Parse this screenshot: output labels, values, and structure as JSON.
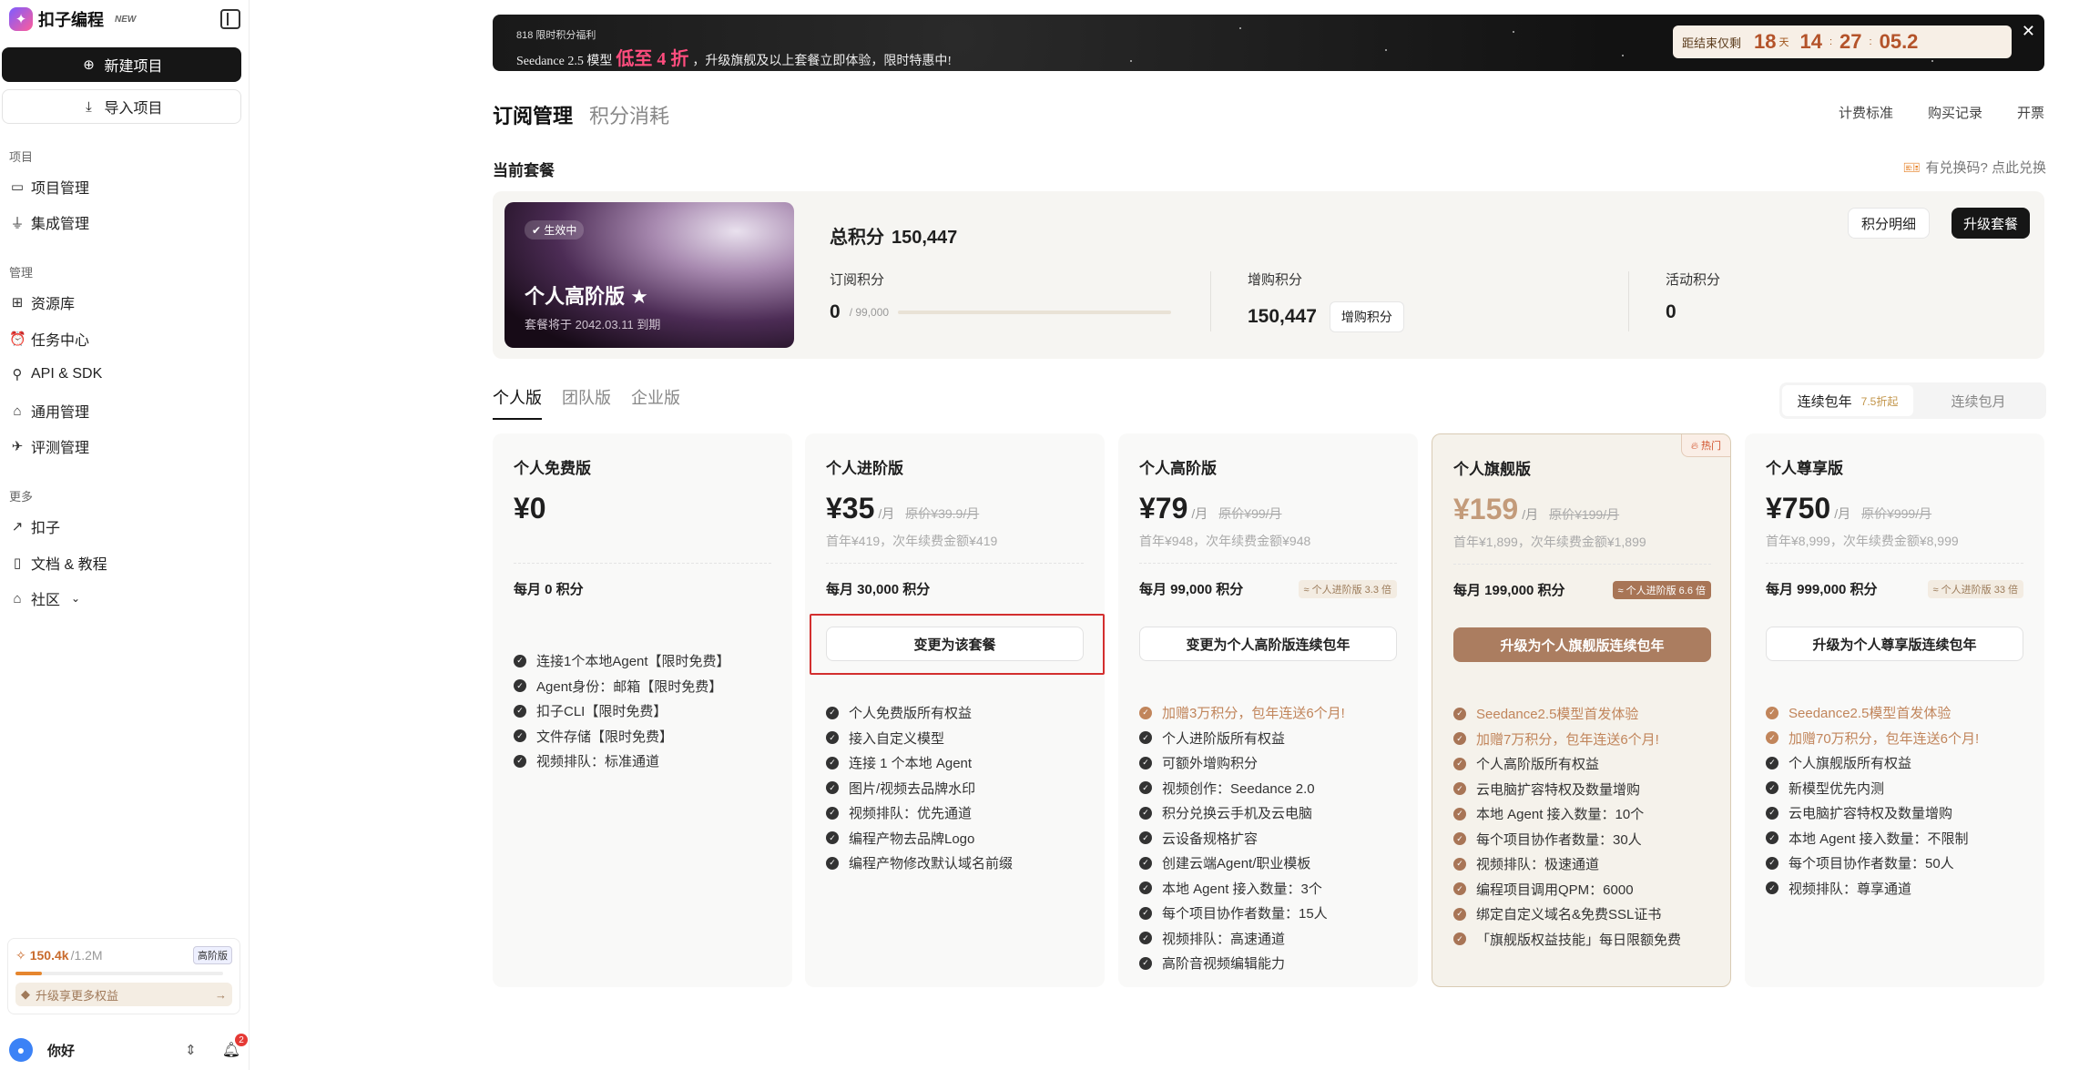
{
  "sidebar": {
    "brand": "扣子编程",
    "new_badge": "NEW",
    "new_project": "新建项目",
    "import_project": "导入项目",
    "sections": [
      {
        "label": "项目",
        "items": [
          {
            "label": "项目管理",
            "icon": "folder-icon"
          },
          {
            "label": "集成管理",
            "icon": "plug-icon"
          }
        ]
      },
      {
        "label": "管理",
        "items": [
          {
            "label": "资源库",
            "icon": "grid-icon"
          },
          {
            "label": "任务中心",
            "icon": "alarm-icon"
          },
          {
            "label": "API & SDK",
            "icon": "api-icon"
          },
          {
            "label": "通用管理",
            "icon": "store-icon"
          },
          {
            "label": "评测管理",
            "icon": "telescope-icon"
          }
        ]
      },
      {
        "label": "更多",
        "items": [
          {
            "label": "扣子",
            "icon": "arrow-up-right-icon"
          },
          {
            "label": "文档 & 教程",
            "icon": "book-icon"
          },
          {
            "label": "社区",
            "icon": "community-icon"
          }
        ]
      }
    ],
    "usage": {
      "value": "150.4k",
      "total": "/1.2M",
      "tier": "高阶版",
      "fraction": 0.125,
      "tip": "升级享更多权益"
    },
    "user": {
      "name": "你好",
      "notifications": "2"
    }
  },
  "banner": {
    "small": "818 限时积分福利",
    "pre": "Seedance 2.5 模型",
    "highlight": "低至 4 折",
    "post": "，升级旗舰及以上套餐立即体验，限时特惠中!",
    "countdown_label": "距结束仅剩",
    "days": "18",
    "days_unit": "天",
    "hours": "14",
    "minutes": "27",
    "seconds": "05.2"
  },
  "tabs": {
    "active": "订阅管理",
    "inactive": "积分消耗"
  },
  "top_links": [
    "计费标准",
    "购买记录",
    "开票"
  ],
  "current": {
    "title": "当前套餐",
    "redeem": "有兑换码? 点此兑换",
    "badge": "生效中",
    "plan_name": "个人高阶版 ★",
    "expiry": "套餐将于 2042.03.11 到期",
    "total_label": "总积分",
    "total_value": "150,447",
    "sub_label": "订阅积分",
    "sub_value": "0",
    "sub_total": "/ 99,000",
    "sub_fraction": 0,
    "extra_label": "增购积分",
    "extra_value": "150,447",
    "extra_button": "增购积分",
    "activity_label": "活动积分",
    "activity_value": "0",
    "detail_button": "积分明细",
    "upgrade_button": "升级套餐"
  },
  "plan_tabs": [
    "个人版",
    "团队版",
    "企业版"
  ],
  "billing": {
    "yearly": "连续包年",
    "discount": "7.5折起",
    "monthly": "连续包月"
  },
  "cards": [
    {
      "name": "个人免费版",
      "price": "¥0",
      "per": "",
      "orig": "",
      "first": "",
      "credits": "每月 0 积分",
      "tag": "",
      "cta": "",
      "featured": false,
      "hot": "",
      "features": [
        {
          "t": "连接1个本地Agent【限时免费】"
        },
        {
          "t": "Agent身份：邮箱【限时免费】"
        },
        {
          "t": "扣子CLI【限时免费】"
        },
        {
          "t": "文件存储【限时免费】"
        },
        {
          "t": "视频排队：标准通道"
        }
      ]
    },
    {
      "name": "个人进阶版",
      "price": "¥35",
      "per": "/月",
      "orig": "原价¥39.9/月",
      "first": "首年¥419，次年续费金额¥419",
      "credits": "每月 30,000 积分",
      "tag": "",
      "cta": "变更为该套餐",
      "featured": false,
      "hot": "",
      "features": [
        {
          "t": "个人免费版所有权益"
        },
        {
          "t": "接入自定义模型"
        },
        {
          "t": "连接 1 个本地 Agent"
        },
        {
          "t": "图片/视频去品牌水印"
        },
        {
          "t": "视频排队：优先通道"
        },
        {
          "t": "编程产物去品牌Logo"
        },
        {
          "t": "编程产物修改默认域名前缀"
        }
      ]
    },
    {
      "name": "个人高阶版",
      "price": "¥79",
      "per": "/月",
      "orig": "原价¥99/月",
      "first": "首年¥948，次年续费金额¥948",
      "credits": "每月 99,000 积分",
      "tag": "≈ 个人进阶版 3.3 倍",
      "cta": "变更为个人高阶版连续包年",
      "featured": false,
      "hot": "",
      "features": [
        {
          "t": "加赠3万积分，包年连送6个月!",
          "hl": true
        },
        {
          "t": "个人进阶版所有权益"
        },
        {
          "t": "可额外增购积分"
        },
        {
          "t": "视频创作：Seedance 2.0"
        },
        {
          "t": "积分兑换云手机及云电脑"
        },
        {
          "t": "云设备规格扩容"
        },
        {
          "t": "创建云端Agent/职业模板"
        },
        {
          "t": "本地 Agent 接入数量：3个"
        },
        {
          "t": "每个项目协作者数量：15人"
        },
        {
          "t": "视频排队：高速通道"
        },
        {
          "t": "高阶音视频编辑能力"
        }
      ]
    },
    {
      "name": "个人旗舰版",
      "price": "¥159",
      "per": "/月",
      "orig": "原价¥199/月",
      "first": "首年¥1,899，次年续费金额¥1,899",
      "credits": "每月 199,000 积分",
      "tag": "≈ 个人进阶版 6.6 倍",
      "cta": "升级为个人旗舰版连续包年",
      "featured": true,
      "hot": "热门",
      "features": [
        {
          "t": "Seedance2.5模型首发体验",
          "hl": true
        },
        {
          "t": "加赠7万积分，包年连送6个月!",
          "hl": true
        },
        {
          "t": "个人高阶版所有权益"
        },
        {
          "t": "云电脑扩容特权及数量增购"
        },
        {
          "t": "本地 Agent 接入数量：10个"
        },
        {
          "t": "每个项目协作者数量：30人"
        },
        {
          "t": "视频排队：极速通道"
        },
        {
          "t": "编程项目调用QPM：6000"
        },
        {
          "t": "绑定自定义域名&免费SSL证书"
        },
        {
          "t": "「旗舰版权益技能」每日限额免费"
        }
      ]
    },
    {
      "name": "个人尊享版",
      "price": "¥750",
      "per": "/月",
      "orig": "原价¥999/月",
      "first": "首年¥8,999，次年续费金额¥8,999",
      "credits": "每月 999,000 积分",
      "tag": "≈ 个人进阶版 33 倍",
      "cta": "升级为个人尊享版连续包年",
      "featured": false,
      "hot": "",
      "features": [
        {
          "t": "Seedance2.5模型首发体验",
          "hl": true
        },
        {
          "t": "加赠70万积分，包年连送6个月!",
          "hl": true
        },
        {
          "t": "个人旗舰版所有权益"
        },
        {
          "t": "新模型优先内测"
        },
        {
          "t": "云电脑扩容特权及数量增购"
        },
        {
          "t": "本地 Agent 接入数量：不限制"
        },
        {
          "t": "每个项目协作者数量：50人"
        },
        {
          "t": "视频排队：尊享通道"
        }
      ]
    }
  ]
}
